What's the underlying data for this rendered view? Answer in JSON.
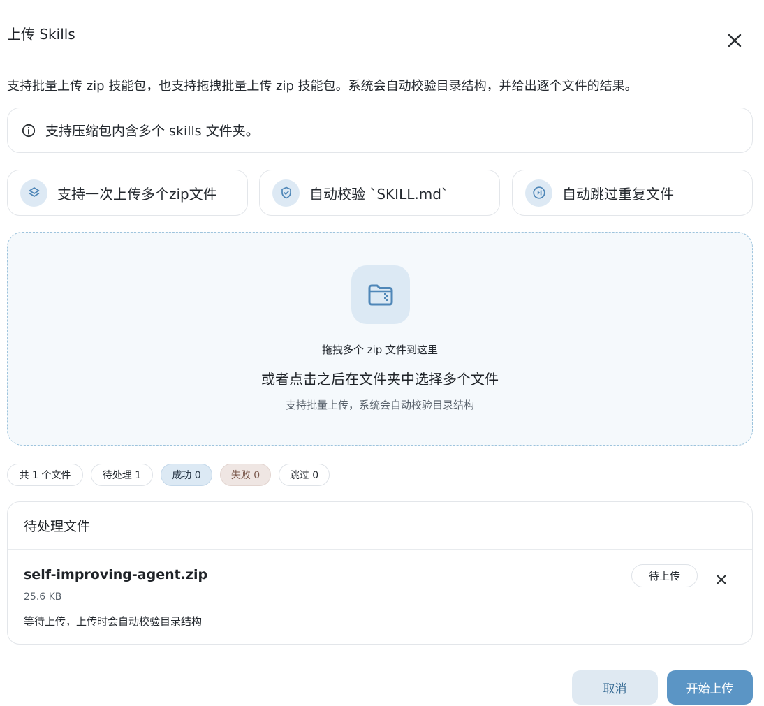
{
  "dialog": {
    "title": "上传 Skills",
    "description": "支持批量上传 zip 技能包，也支持拖拽批量上传 zip 技能包。系统会自动校验目录结构，并给出逐个文件的结果。",
    "info": "支持压缩包内含多个 skills 文件夹。"
  },
  "features": [
    {
      "label": "支持一次上传多个zip文件",
      "icon": "layers-icon"
    },
    {
      "label": "自动校验 `SKILL.md`",
      "icon": "shield-check-icon"
    },
    {
      "label": "自动跳过重复文件",
      "icon": "skip-icon"
    }
  ],
  "dropzone": {
    "icon": "folder-zip-icon",
    "line1": "拖拽多个 zip 文件到这里",
    "line2": "或者点击之后在文件夹中选择多个文件",
    "line3": "支持批量上传，系统会自动校验目录结构"
  },
  "stats": {
    "total": "共 1 个文件",
    "pending": "待处理 1",
    "success": "成功 0",
    "failed": "失败 0",
    "skipped": "跳过 0"
  },
  "pending_section": {
    "header": "待处理文件",
    "files": [
      {
        "name": "self-improving-agent.zip",
        "size": "25.6 KB",
        "note": "等待上传，上传时会自动校验目录结构",
        "status": "待上传"
      }
    ]
  },
  "buttons": {
    "cancel": "取消",
    "start": "开始上传"
  },
  "colors": {
    "accent": "#5b95c5",
    "accent_light": "#dce9f4",
    "fail_bg": "#efe6e3"
  }
}
